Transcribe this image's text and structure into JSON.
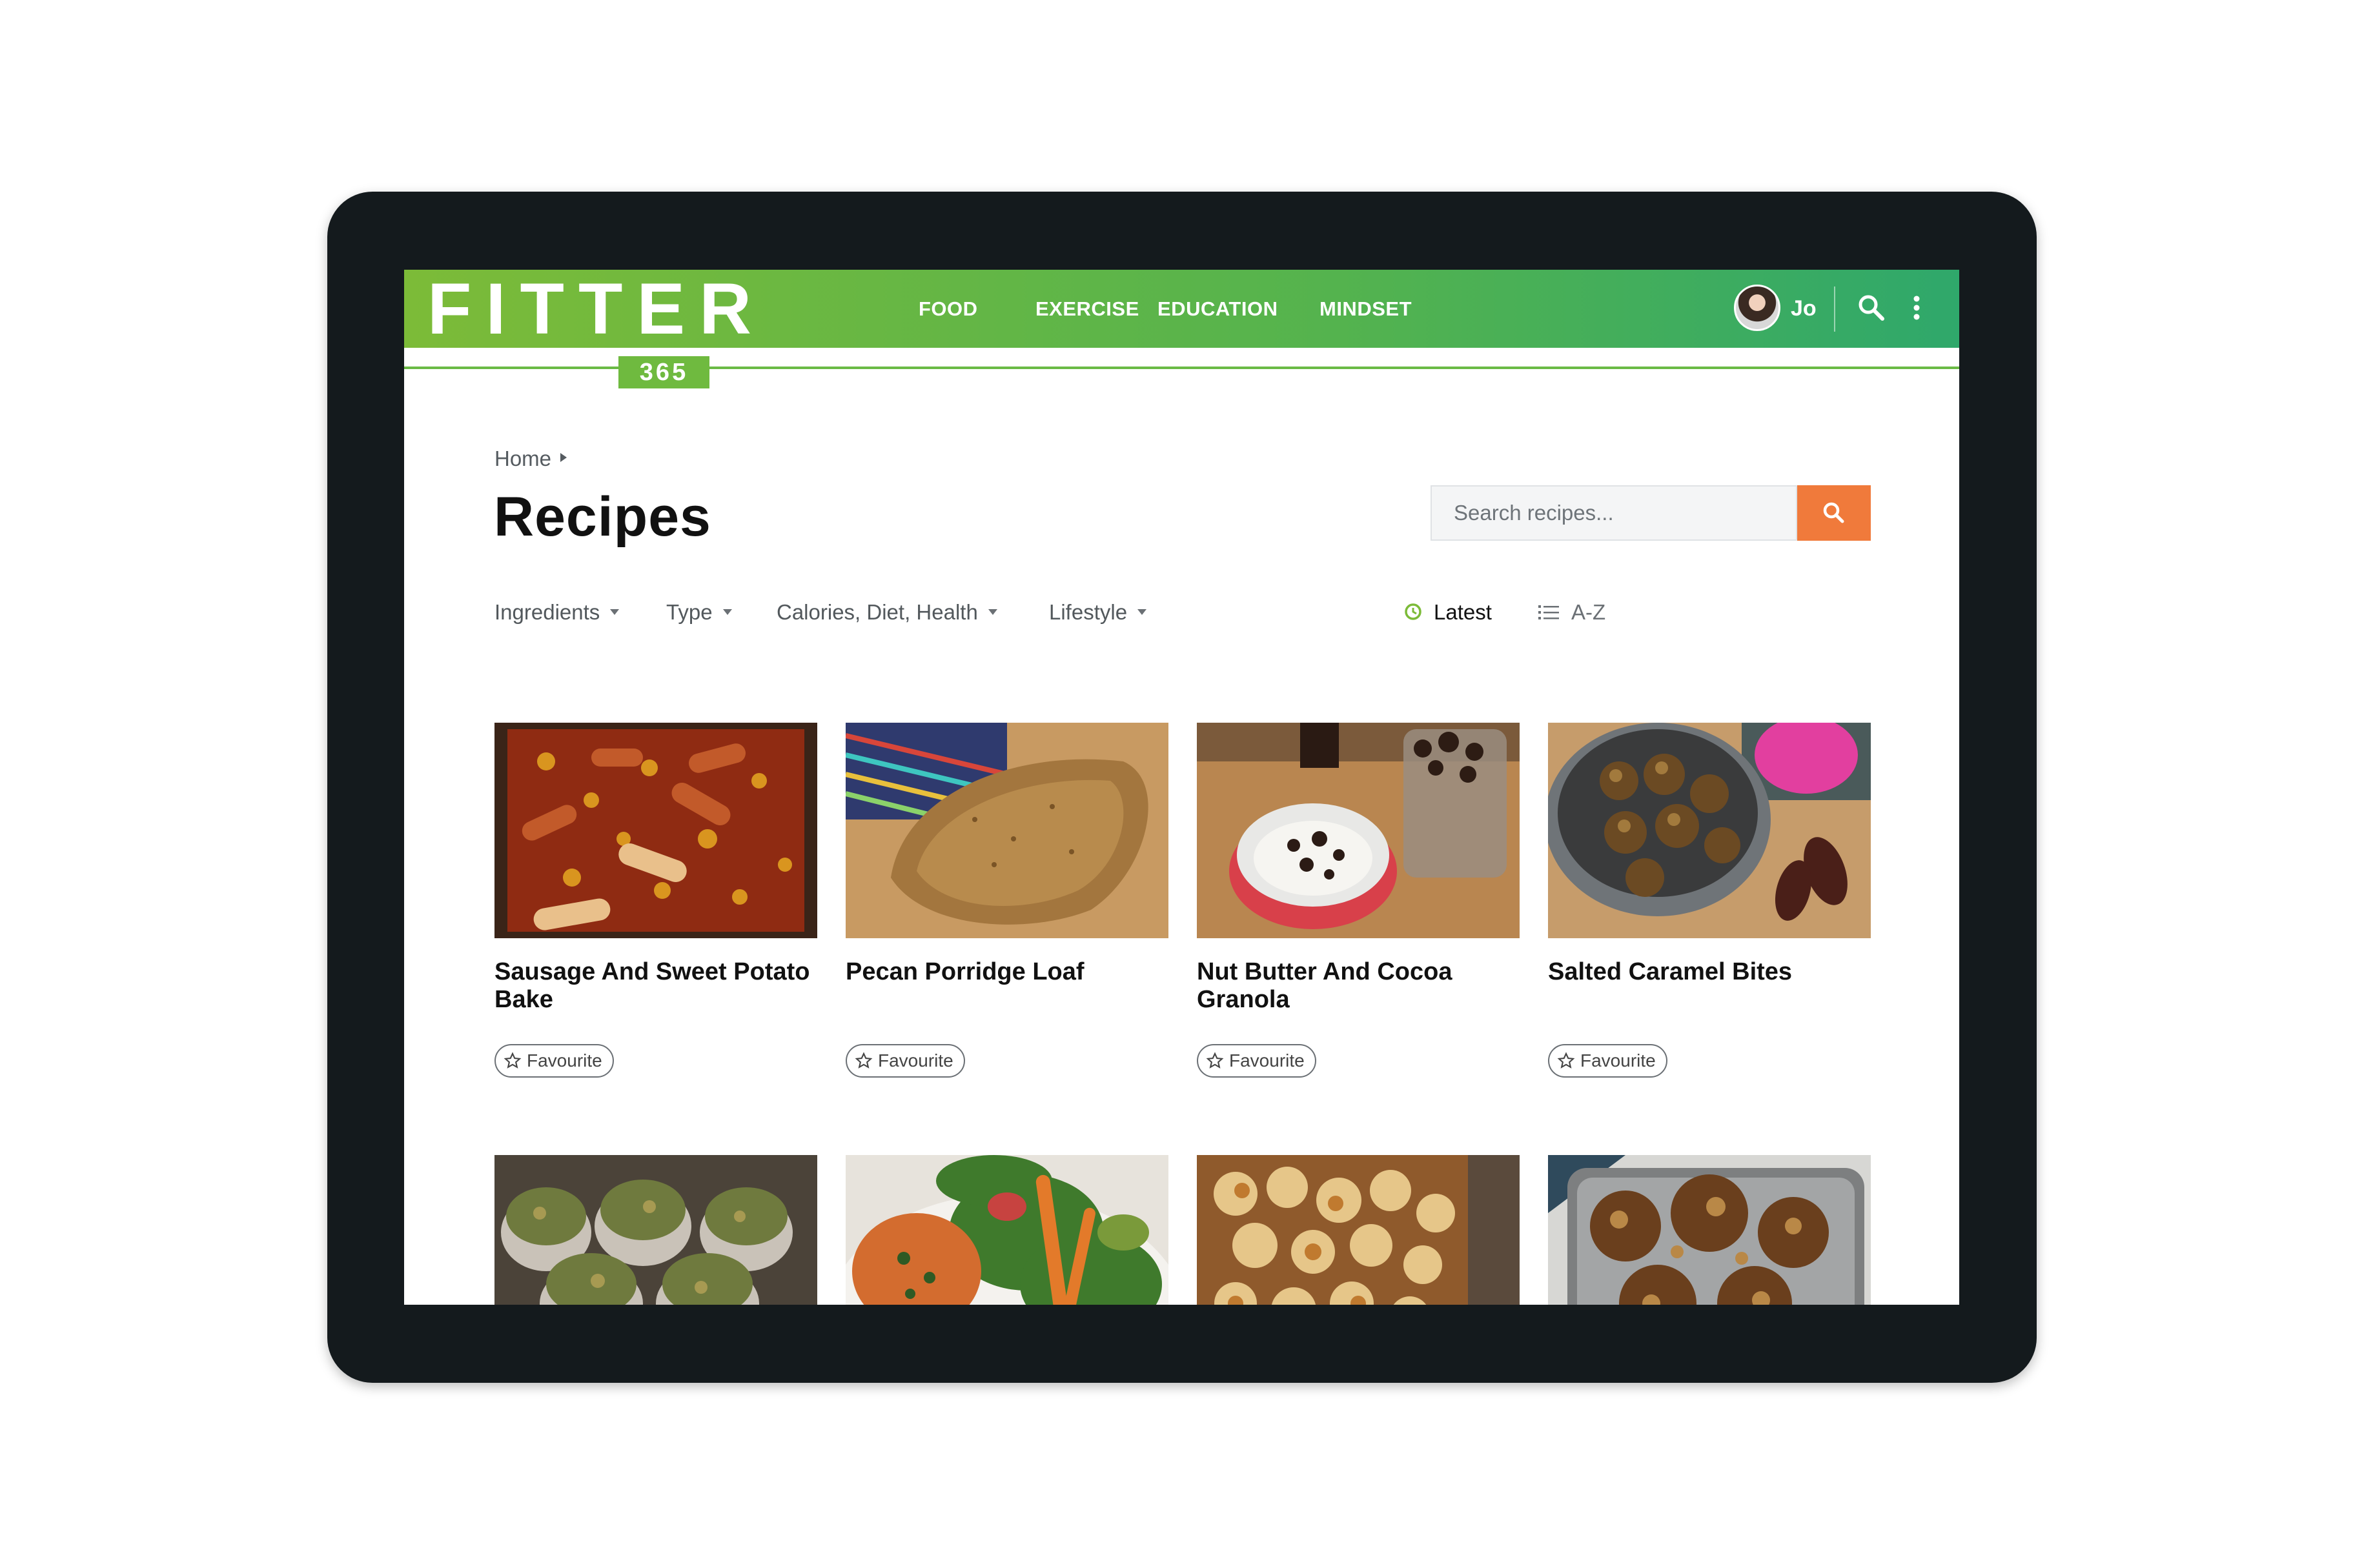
{
  "brand": {
    "word": "FITTER",
    "badge": "365"
  },
  "nav": {
    "items": [
      {
        "label": "FOOD"
      },
      {
        "label": "EXERCISE"
      },
      {
        "label": "EDUCATION"
      },
      {
        "label": "MINDSET"
      }
    ],
    "user_name": "Jo"
  },
  "breadcrumb": {
    "home": "Home"
  },
  "page": {
    "title": "Recipes"
  },
  "search": {
    "placeholder": "Search recipes..."
  },
  "filters": [
    {
      "label": "Ingredients"
    },
    {
      "label": "Type"
    },
    {
      "label": "Calories, Diet, Health"
    },
    {
      "label": "Lifestyle"
    }
  ],
  "sort": {
    "latest": "Latest",
    "az": "A-Z"
  },
  "recipes": [
    {
      "title": "Sausage And Sweet Potato Bake",
      "favourite_label": "Favourite"
    },
    {
      "title": "Pecan Porridge Loaf",
      "favourite_label": "Favourite"
    },
    {
      "title": "Nut Butter And Cocoa Granola",
      "favourite_label": "Favourite"
    },
    {
      "title": "Salted Caramel Bites",
      "favourite_label": "Favourite"
    },
    {
      "title": "",
      "favourite_label": ""
    },
    {
      "title": "",
      "favourite_label": ""
    },
    {
      "title": "",
      "favourite_label": ""
    },
    {
      "title": "",
      "favourite_label": ""
    }
  ],
  "colors": {
    "nav_green_start": "#7cbb38",
    "nav_green_end": "#2fa86b",
    "search_button": "#f07a3b",
    "latest_icon": "#7cbb38",
    "tablet_frame": "#141a1d"
  }
}
